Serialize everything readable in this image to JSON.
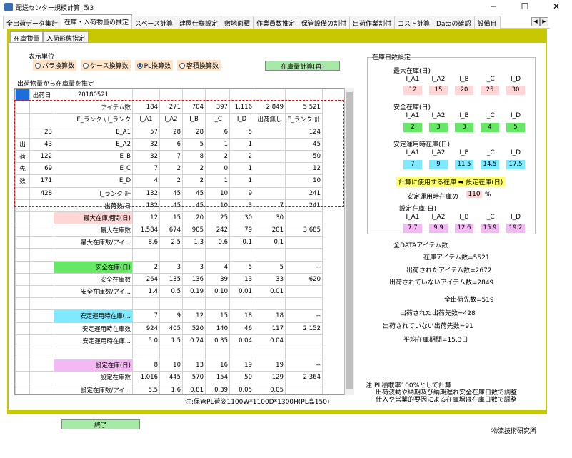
{
  "window": {
    "title": "配送センター規模計算_改3"
  },
  "tabs": [
    "全出荷データ集計",
    "在庫・入荷物量の推定",
    "スペース計算",
    "建屋仕様設定",
    "敷地面積",
    "作業員数推定",
    "保管設備の割付",
    "出荷作業割付",
    "コスト計算",
    "Dataの確認",
    "設備自"
  ],
  "subtabs": [
    "在庫物量",
    "入荷形態指定"
  ],
  "unit": {
    "label": "表示単位",
    "options": [
      "バラ換算数",
      "ケース換算数",
      "PL換算数",
      "容積換算数"
    ],
    "selected": 2
  },
  "calc_button": "在庫量計算(再)",
  "grid_title": "出荷物量から在庫量を推定",
  "side_title": "在庫日数設定",
  "rank_headers": [
    "I_A1",
    "I_A2",
    "I_B",
    "I_C",
    "I_D"
  ],
  "max_stock": {
    "label": "最大在庫(日)",
    "values": [
      "12",
      "15",
      "20",
      "25",
      "30"
    ],
    "color": "#ffd6d6"
  },
  "safety_stock": {
    "label": "安全在庫(日)",
    "values": [
      "2",
      "3",
      "3",
      "4",
      "5"
    ],
    "color": "#66e866"
  },
  "operating_stock": {
    "label": "安定運用時在庫(日)",
    "values": [
      "7",
      "9",
      "11.5",
      "14.5",
      "17.5"
    ],
    "color": "#7fe9ff"
  },
  "calc_note": "計算に使用する在庫 ➡ 設定在庫(日)",
  "operating_pct": {
    "label": "安定運用時在庫の",
    "value": "110",
    "unit": "%"
  },
  "set_stock": {
    "label": "設定在庫(日)",
    "values": [
      "7.7",
      "9.9",
      "12.6",
      "15.9",
      "19.2"
    ],
    "color": "#f4b8f4"
  },
  "stats": [
    "全DATAアイテム数",
    "在庫アイテム数=5521",
    "出荷されたアイテム数=2672",
    "出荷されていないアイテム数=2849",
    "全出荷先数=519",
    "出荷された出荷先数=428",
    "出荷されていない出荷先数=91",
    "平均在庫期間=15.3日"
  ],
  "footnote": "注:保管PL荷姿1100W*1100D*1300H(PL高150)",
  "side_note": [
    "注:PL積載率100%として計算",
    "出荷波動や納期及び納期遅れ安全在庫日数で調整",
    "仕入や営業的要因による在庫増は在庫日数で調整"
  ],
  "close_button": "終了",
  "company": "物流技術研究所",
  "table": {
    "rows": [
      [
        "",
        "出荷日",
        "20180521",
        "",
        "",
        "",
        "",
        "",
        "",
        ""
      ],
      [
        "",
        "",
        "アイテム数",
        "184",
        "271",
        "704",
        "397",
        "1,116",
        "2,849",
        "5,521"
      ],
      [
        "",
        "",
        "E_ランク \\ I_ランク",
        "I_A1",
        "I_A2",
        "I_B",
        "I_C",
        "I_D",
        "出荷無し",
        "E_ランク 計"
      ],
      [
        "",
        "23",
        "E_A1",
        "57",
        "28",
        "28",
        "6",
        "5",
        "",
        "124"
      ],
      [
        "出",
        "43",
        "E_A2",
        "32",
        "6",
        "5",
        "1",
        "1",
        "",
        "45"
      ],
      [
        "荷",
        "122",
        "E_B",
        "32",
        "7",
        "8",
        "2",
        "2",
        "",
        "50"
      ],
      [
        "先",
        "69",
        "E_C",
        "7",
        "2",
        "2",
        "0",
        "1",
        "",
        "12"
      ],
      [
        "数",
        "171",
        "E_D",
        "4",
        "2",
        "2",
        "1",
        "1",
        "",
        "10"
      ],
      [
        "",
        "428",
        "I_ランク 計",
        "132",
        "45",
        "45",
        "10",
        "9",
        "",
        "241"
      ],
      [
        "",
        "",
        "出荷数/日",
        "132",
        "45",
        "45",
        "10",
        "3",
        "7",
        "241"
      ],
      [
        "",
        "",
        "最大在庫期間(日)",
        "12",
        "15",
        "20",
        "25",
        "30",
        "30",
        ""
      ],
      [
        "",
        "",
        "最大在庫数",
        "1,584",
        "674",
        "905",
        "242",
        "79",
        "201",
        "3,685"
      ],
      [
        "",
        "",
        "最大在庫数/アイ...",
        "8.6",
        "2.5",
        "1.3",
        "0.6",
        "0.1",
        "0.1",
        ""
      ],
      [
        "",
        "",
        "",
        "",
        "",
        "",
        "",
        "",
        "",
        ""
      ],
      [
        "",
        "",
        "安全在庫(日)",
        "2",
        "3",
        "3",
        "4",
        "5",
        "5",
        "--"
      ],
      [
        "",
        "",
        "安全在庫数",
        "264",
        "135",
        "136",
        "39",
        "13",
        "33",
        "620"
      ],
      [
        "",
        "",
        "安全在庫数/アイ...",
        "1.4",
        "0.5",
        "0.19",
        "0.10",
        "0.01",
        "0.01",
        ""
      ],
      [
        "",
        "",
        "",
        "",
        "",
        "",
        "",
        "",
        "",
        ""
      ],
      [
        "",
        "",
        "安定運用時在庫(...",
        "7",
        "9",
        "12",
        "15",
        "18",
        "18",
        "--"
      ],
      [
        "",
        "",
        "安定運用時在庫数",
        "924",
        "405",
        "520",
        "140",
        "46",
        "117",
        "2,152"
      ],
      [
        "",
        "",
        "安定運用時在庫...",
        "5.0",
        "1.5",
        "0.74",
        "0.35",
        "0.04",
        "0.04",
        ""
      ],
      [
        "",
        "",
        "",
        "",
        "",
        "",
        "",
        "",
        "",
        ""
      ],
      [
        "",
        "",
        "設定在庫(日)",
        "8",
        "10",
        "13",
        "16",
        "19",
        "19",
        "--"
      ],
      [
        "",
        "",
        "設定在庫数",
        "1,016",
        "445",
        "570",
        "154",
        "50",
        "129",
        "2,364"
      ],
      [
        "",
        "",
        "設定在庫数/アイ...",
        "5.5",
        "1.6",
        "0.81",
        "0.39",
        "0.05",
        "0.05",
        ""
      ]
    ],
    "label_colors": {
      "10": "#ffd6d6",
      "14": "#66e866",
      "18": "#7fe9ff",
      "22": "#f4b8f4"
    }
  }
}
